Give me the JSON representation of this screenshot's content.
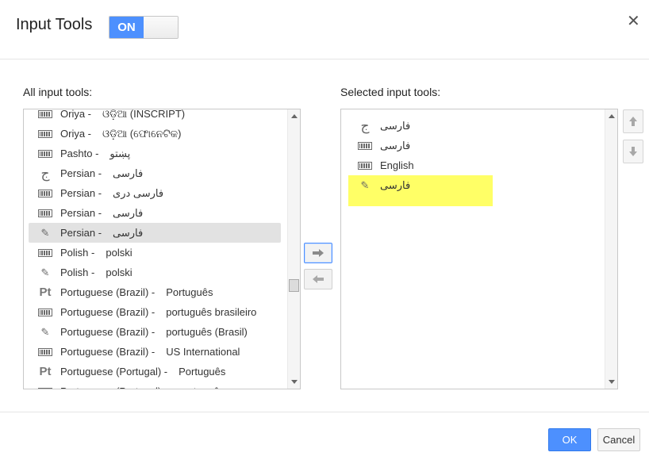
{
  "dialog": {
    "title": "Input Tools",
    "toggle_label": "ON",
    "close_label": "✕"
  },
  "all_tools": {
    "label": "All input tools:",
    "items": [
      {
        "icon": "keyboard-icon",
        "name": "Oriya -",
        "native": "ଓଡ଼ିଆ (INSCRIPT)",
        "rtl": false
      },
      {
        "icon": "keyboard-icon",
        "name": "Oriya -",
        "native": "ଓଡ଼ିଆ (ଫୋନେଟିକ)",
        "rtl": false
      },
      {
        "icon": "keyboard-icon",
        "name": "Pashto -",
        "native": "پښتو",
        "rtl": true
      },
      {
        "icon": "transliteration-icon",
        "name": "Persian -",
        "native": "فارسی",
        "rtl": true
      },
      {
        "icon": "keyboard-icon",
        "name": "Persian -",
        "native": "فارسی دری",
        "rtl": true
      },
      {
        "icon": "keyboard-icon",
        "name": "Persian -",
        "native": "فارسی",
        "rtl": true
      },
      {
        "icon": "pencil-icon",
        "name": "Persian -",
        "native": "فارسی",
        "rtl": true,
        "selected": true
      },
      {
        "icon": "keyboard-icon",
        "name": "Polish -",
        "native": "polski",
        "rtl": false
      },
      {
        "icon": "pencil-icon",
        "name": "Polish -",
        "native": "polski",
        "rtl": false
      },
      {
        "icon": "pt-icon",
        "name": "Portuguese (Brazil) -",
        "native": "Português",
        "rtl": false
      },
      {
        "icon": "keyboard-icon",
        "name": "Portuguese (Brazil) -",
        "native": "português brasileiro",
        "rtl": false
      },
      {
        "icon": "pencil-icon",
        "name": "Portuguese (Brazil) -",
        "native": "português (Brasil)",
        "rtl": false
      },
      {
        "icon": "keyboard-icon",
        "name": "Portuguese (Brazil) -",
        "native": "US International",
        "rtl": false
      },
      {
        "icon": "pt-icon",
        "name": "Portuguese (Portugal) -",
        "native": "Português",
        "rtl": false
      },
      {
        "icon": "keyboard-icon",
        "name": "Portuguese (Portugal) -",
        "native": "português europeu",
        "rtl": false
      }
    ]
  },
  "selected_tools": {
    "label": "Selected input tools:",
    "items": [
      {
        "icon": "transliteration-icon",
        "text": "فارسی",
        "rtl": true
      },
      {
        "icon": "keyboard-icon",
        "text": "فارسی",
        "rtl": true
      },
      {
        "icon": "keyboard-icon",
        "text": "English",
        "rtl": false
      },
      {
        "icon": "pencil-icon",
        "text": "فارسی",
        "rtl": true,
        "highlighted": true
      }
    ],
    "highlight_color": "#ffff66"
  },
  "buttons": {
    "ok": "OK",
    "cancel": "Cancel"
  },
  "colors": {
    "accent": "#4d90fe"
  }
}
